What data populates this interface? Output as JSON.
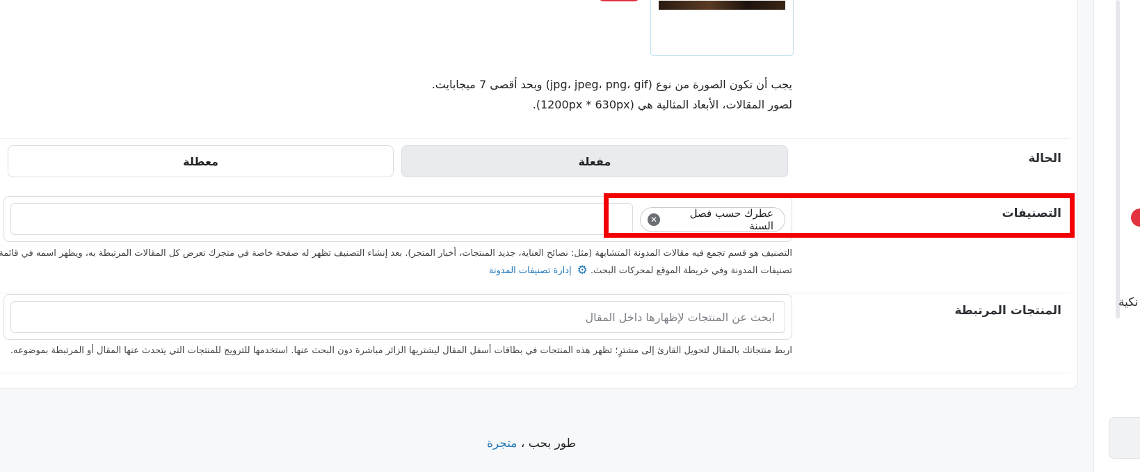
{
  "image_section": {
    "format_note": "يجب أن تكون الصورة من نوع (jpg، jpeg، png، gif) وبحد أقصى 7 ميجابايت.",
    "dimensions_note": "لصور المقالات، الأبعاد المثالية هي (1200px * 630px)."
  },
  "status": {
    "label": "الحالة",
    "active_label": "مفعلة",
    "inactive_label": "معطلة",
    "selected": "مفعلة"
  },
  "categories": {
    "label": "التصنيفات",
    "selected_tags": [
      "عطرك حسب فصل السنة"
    ],
    "help_line1": "التصنيف هو قسم تجمع فيه مقالات المدونة المتشابهة (مثل: نصائح العناية، جديد المنتجات، أخبار المتجر). بعد إنشاء التصنيف تظهر له صفحة خاصة في متجرك تعرض كل المقالات المرتبطة به، ويظهر اسمه في قائمة",
    "help_line2": "تصنيفات المدونة وفي خريطة الموقع لمحركات البحث.",
    "manage_link": "إدارة تصنيفات المدونة"
  },
  "related_products": {
    "label": "المنتجات المرتبطة",
    "search_placeholder": "ابحث عن المنتجات لإظهارها داخل المقال",
    "search_value": "",
    "help": "اربط منتجاتك بالمقال لتحويل القارئ إلى مشترٍ؛ تظهر هذه المنتجات في بطاقات أسفل المقال ليشتريها الزائر مباشرة دون البحث عنها. استخدمها للترويج للمنتجات التي يتحدث عنها المقال أو المرتبطة بموضوعه."
  },
  "side_panel": {
    "truncated_text": "نكية"
  },
  "footer": {
    "prefix": "طور بحب ،",
    "brand": "متجرة"
  },
  "colors": {
    "accent_link": "#1f76b8",
    "highlight": "#f20000",
    "badge_red": "#e2333f"
  },
  "icons": {
    "gear": "gear-icon",
    "tag_remove": "close-circle-icon"
  }
}
